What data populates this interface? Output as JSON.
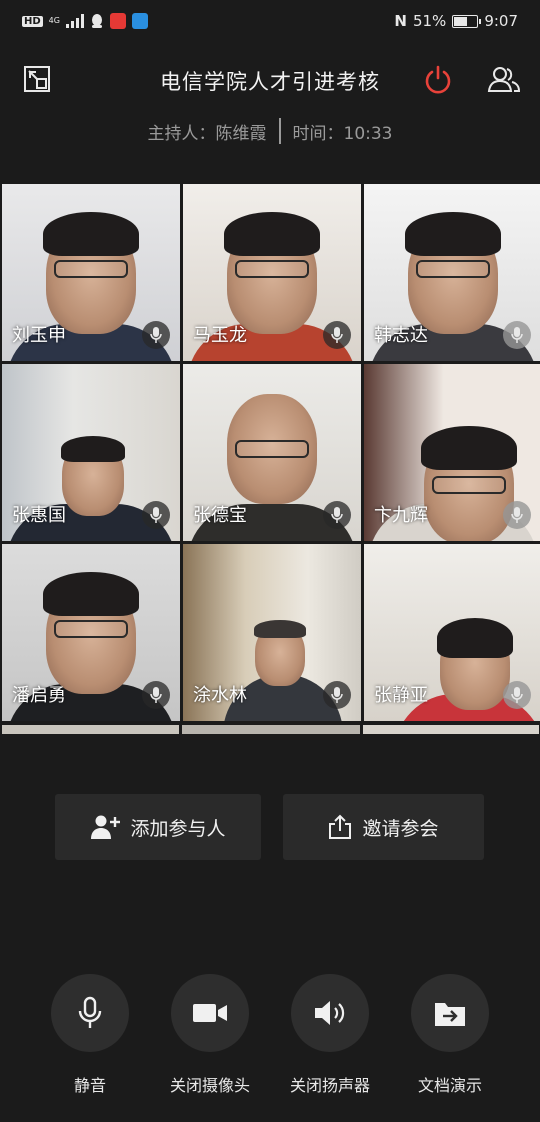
{
  "status_bar": {
    "hd": "HD",
    "network": "4G",
    "nfc": "N",
    "battery": "51%",
    "battery_level": 0.51,
    "time": "9:07"
  },
  "header": {
    "title": "电信学院人才引进考核",
    "host_label": "主持人：陈维霞",
    "time_label": "时间：10:33"
  },
  "participants": [
    {
      "name": "刘玉申",
      "mic": "mic-icon"
    },
    {
      "name": "马玉龙",
      "mic": "mic-icon"
    },
    {
      "name": "韩志达",
      "mic": "mic-icon"
    },
    {
      "name": "张惠国",
      "mic": "mic-icon"
    },
    {
      "name": "张德宝",
      "mic": "mic-icon"
    },
    {
      "name": "卞九辉",
      "mic": "mic-icon"
    },
    {
      "name": "潘启勇",
      "mic": "mic-icon"
    },
    {
      "name": "涂水林",
      "mic": "mic-icon"
    },
    {
      "name": "张静亚",
      "mic": "mic-icon"
    }
  ],
  "actions": {
    "add_participant": "添加参与人",
    "invite": "邀请参会"
  },
  "controls": {
    "mute": "静音",
    "camera_off": "关闭摄像头",
    "speaker_off": "关闭扬声器",
    "doc_share": "文档演示"
  },
  "colors": {
    "background": "#1b1b1b",
    "leave_red": "#e8423a"
  }
}
